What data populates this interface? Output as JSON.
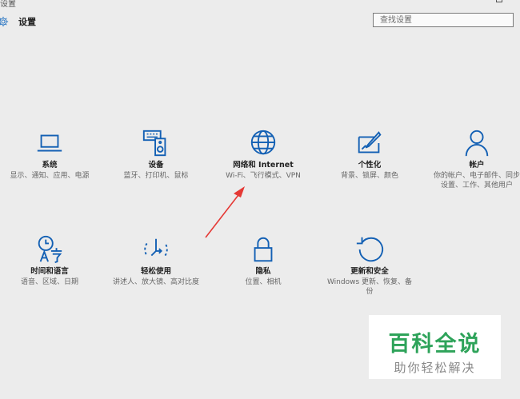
{
  "window": {
    "title": "设置"
  },
  "header": {
    "title": "设置",
    "icon": "gear-icon"
  },
  "search": {
    "placeholder": "查找设置"
  },
  "accent": "#1360b4",
  "tiles": [
    {
      "icon": "laptop-icon",
      "title": "系统",
      "desc": "显示、通知、应用、电源"
    },
    {
      "icon": "keyboard-speaker-icon",
      "title": "设备",
      "desc": "蓝牙、打印机、鼠标"
    },
    {
      "icon": "globe-icon",
      "title": "网络和 Internet",
      "desc": "Wi-Fi、飞行模式、VPN"
    },
    {
      "icon": "personalization-icon",
      "title": "个性化",
      "desc": "背景、锁屏、颜色"
    },
    {
      "icon": "person-icon",
      "title": "帐户",
      "desc": "你的帐户、电子邮件、同步设置、工作、其他用户"
    },
    {
      "icon": "time-language-icon",
      "title": "时间和语言",
      "desc": "语音、区域、日期"
    },
    {
      "icon": "ease-of-access-icon",
      "title": "轻松使用",
      "desc": "讲述人、放大镜、高对比度"
    },
    {
      "icon": "lock-icon",
      "title": "隐私",
      "desc": "位置、相机"
    },
    {
      "icon": "update-security-icon",
      "title": "更新和安全",
      "desc": "Windows 更新、恢复、备份"
    }
  ],
  "annotation": {
    "color": "#e53935",
    "icon": "red-arrow-icon"
  },
  "watermark": {
    "main": "百科全说",
    "sub": "助你轻松解决",
    "color": "#2ea35a"
  }
}
